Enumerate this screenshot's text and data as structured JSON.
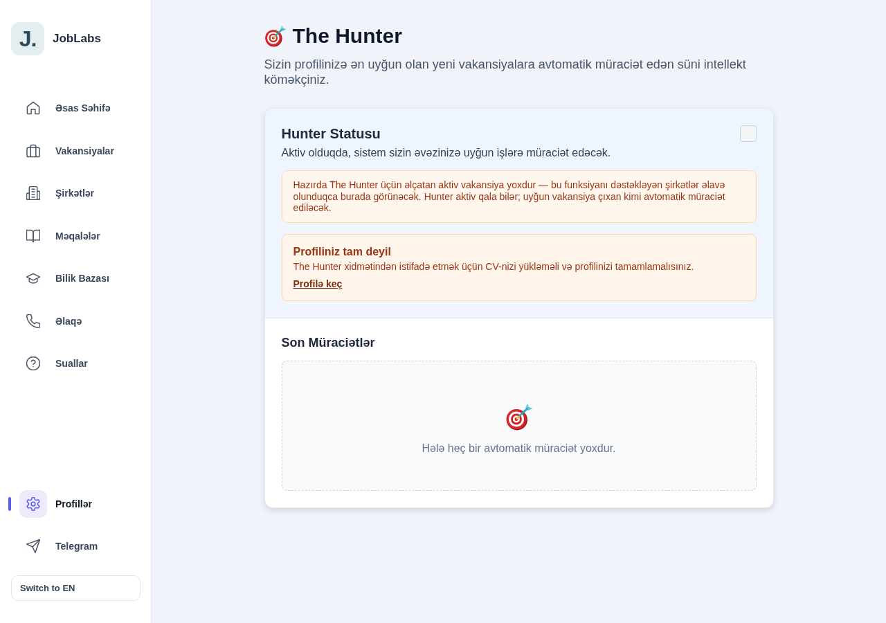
{
  "sidebar": {
    "logo": {
      "mark": "J.",
      "name": "JobLabs"
    },
    "nav": [
      {
        "label": "Əsas Səhifə",
        "kind": "home",
        "selected": false
      },
      {
        "label": "Vakansiyalar",
        "kind": "briefcase",
        "selected": false
      },
      {
        "label": "Şirkətlər",
        "kind": "building",
        "selected": false
      },
      {
        "label": "Məqalələr",
        "kind": "book",
        "selected": false
      },
      {
        "label": "Bilik Bazası",
        "kind": "cap",
        "selected": false
      },
      {
        "label": "Əlaqə",
        "kind": "phone",
        "selected": false
      },
      {
        "label": "Suallar",
        "kind": "question",
        "selected": false
      }
    ],
    "bottom_nav": [
      {
        "label": "Profillər",
        "kind": "gear",
        "selected": true
      },
      {
        "label": "Telegram",
        "kind": "send",
        "selected": false
      }
    ],
    "language_button": "Switch to EN"
  },
  "header": {
    "title": "The Hunter",
    "subtitle": "Sizin profilinizə ən uyğun olan yeni vakansiyalara avtomatik müraciət edən süni intellekt köməkçiniz."
  },
  "status_card": {
    "title": "Hunter Statusu",
    "description": "Aktiv olduqda, sistem sizin əvəzinizə uyğun işlərə müraciət edəcək.",
    "checked": false,
    "notice": "Hazırda The Hunter üçün əlçatan aktiv vakansiya yoxdur — bu funksiyanı dəstəkləyən şirkətlər əlavə olunduqca burada görünəcək. Hunter aktiv qala bilər; uyğun vakansiya çıxan kimi avtomatik müraciət ediləcək.",
    "warning": {
      "title": "Profiliniz tam deyil",
      "text": "The Hunter xidmətindən istifadə etmək üçün CV-nizi yükləməli və profilinizi tamamlamalısınız.",
      "link": "Profilə keç"
    }
  },
  "recent": {
    "title": "Son Müraciətlər",
    "empty_text": "Hələ heç bir avtomatik müraciət yoxdur."
  }
}
